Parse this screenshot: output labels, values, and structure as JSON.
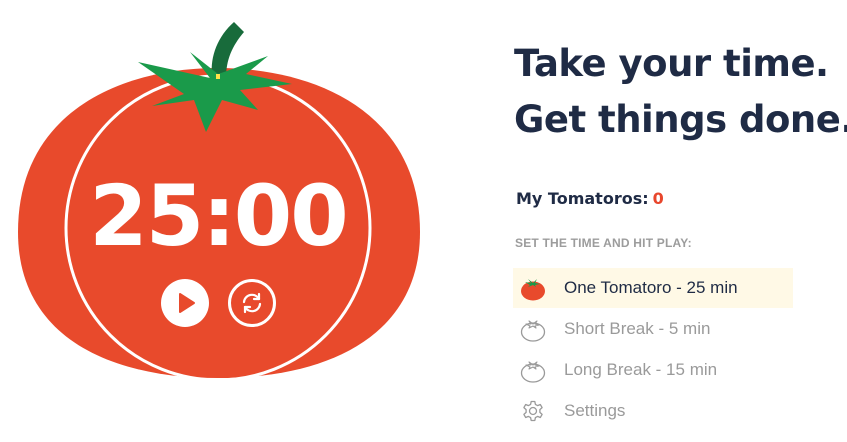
{
  "timer": {
    "display": "25:00",
    "play_label": "Play",
    "reset_label": "Reset"
  },
  "headline": {
    "line1": "Take your time.",
    "line2": "Get things done."
  },
  "tomatoros": {
    "label": "My Tomatoros:",
    "count": "0"
  },
  "instruction": "SET THE TIME AND HIT PLAY:",
  "menu": {
    "items": [
      {
        "label": "One Tomatoro - 25 min",
        "icon": "tomato-filled-icon",
        "selected": true
      },
      {
        "label": "Short Break - 5 min",
        "icon": "tomato-outline-icon",
        "selected": false
      },
      {
        "label": "Long Break - 15 min",
        "icon": "tomato-outline-icon",
        "selected": false
      },
      {
        "label": "Settings",
        "icon": "gear-icon",
        "selected": false
      }
    ]
  },
  "colors": {
    "tomato_red": "#e84a2c",
    "leaf_green": "#1a9a4a",
    "stem_green": "#186b3b",
    "heading_navy": "#1f2b45",
    "accent_red": "#e8462c",
    "muted_gray": "#9a9a9a",
    "highlight": "#fff9e6"
  }
}
